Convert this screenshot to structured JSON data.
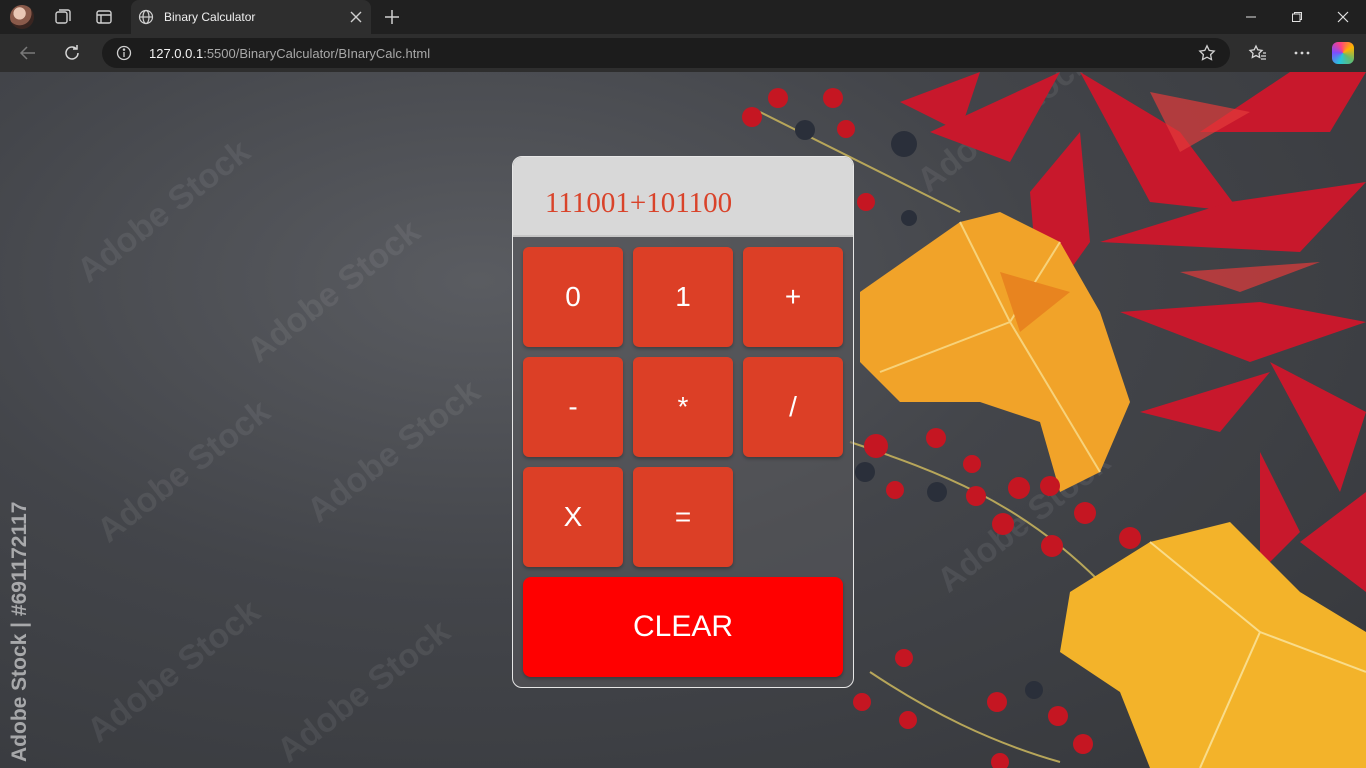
{
  "browser": {
    "tab_title": "Binary Calculator",
    "url_host": "127.0.0.1",
    "url_rest": ":5500/BinaryCalculator/BInaryCalc.html",
    "icons": [
      "profile-avatar",
      "workspaces-icon",
      "tab-actions-icon",
      "globe-icon",
      "close-icon",
      "new-tab-icon",
      "minimize-icon",
      "maximize-icon",
      "window-close-icon",
      "back-icon",
      "refresh-icon",
      "info-icon",
      "favorite-star-icon",
      "favorites-icon",
      "more-icon",
      "copilot-icon"
    ]
  },
  "page": {
    "background": {
      "watermark_text": "Adobe Stock",
      "side_text": "Adobe Stock | #691172117"
    },
    "calculator": {
      "display_value": "111001+101100",
      "keys": {
        "zero": "0",
        "one": "1",
        "plus": "+",
        "minus": "-",
        "multiply": "*",
        "divide": "/",
        "x": "X",
        "equals": "=",
        "clear": "CLEAR"
      },
      "colors": {
        "key": "#dc3f26",
        "clear_key": "#ff0000",
        "display_bg": "#d8d8d8",
        "display_text": "#d9432a"
      }
    }
  }
}
